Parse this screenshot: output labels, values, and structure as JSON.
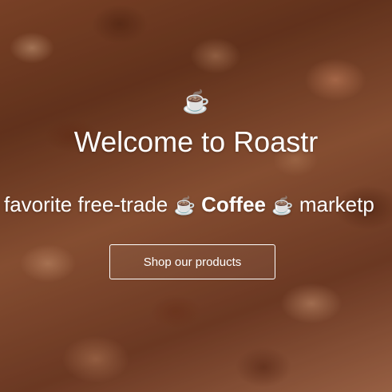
{
  "hero": {
    "logo_glyph": "☕",
    "title": "Welcome to Roastr",
    "tagline": {
      "before": "favorite free-trade",
      "cup_left": "☕",
      "highlight": "Coffee",
      "cup_right": "☕",
      "after": "marketp"
    },
    "cta_label": "Shop our products"
  },
  "colors": {
    "text": "#ffffff",
    "background_base": "#8a4a2c"
  },
  "icons": [
    "coffee-cup-icon"
  ]
}
